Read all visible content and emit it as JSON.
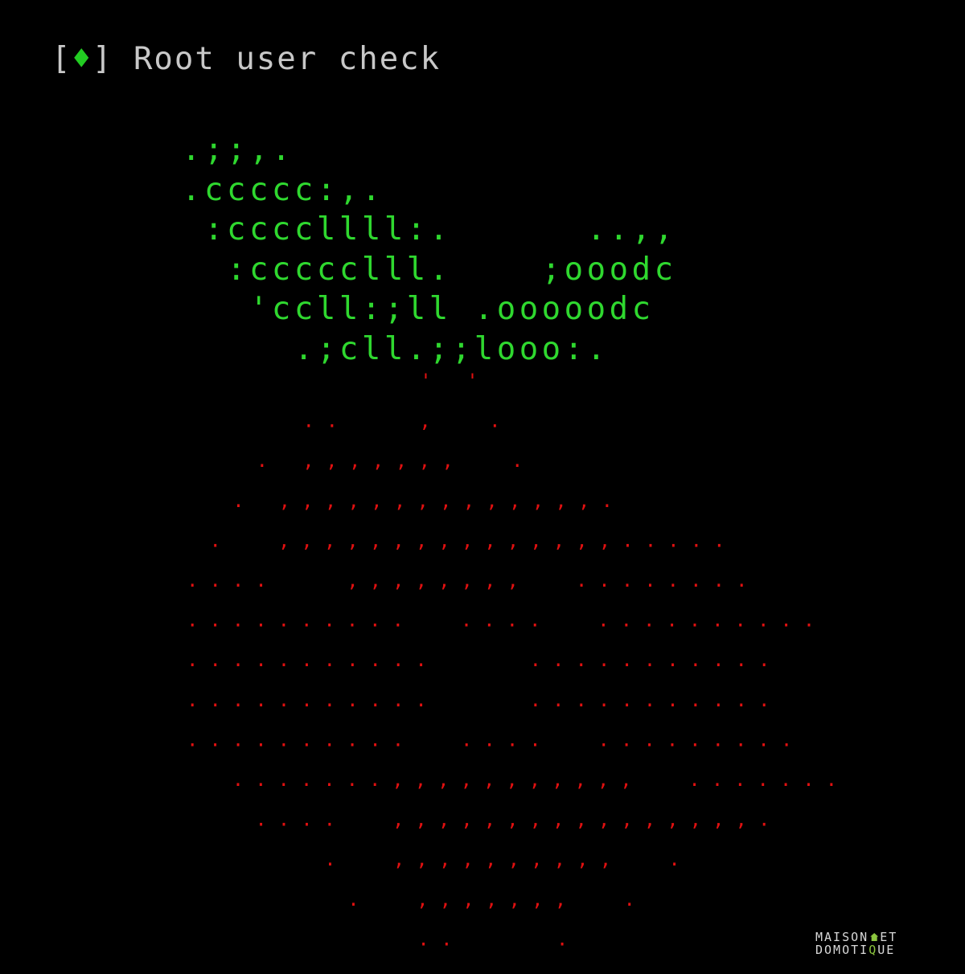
{
  "terminal": {
    "status": {
      "bracket_open": "[",
      "symbol": "♦",
      "bracket_close": "]",
      "text": "Root user check"
    },
    "leaf_lines": [
      ".;;,.",
      ".ccccc:,.",
      " :ccccllll:.      ..,,",
      "  :ccccclll.    ;ooodc",
      "   'ccll:;ll .ooooodc",
      "     .;cll.;;looo:."
    ],
    "berry_rows": [
      "          ' '",
      "     ..   ,  .",
      "   . ,,,,,,,  .",
      "  . ,,,,,,,,,,,,,,.",
      " .  ,,,,,,,,,,,,,,,.....",
      "....   ,,,,,,,,  ........",
      "..........  ....  ..........",
      "...........    ...........",
      "...........    ...........",
      "..........  ....  .........",
      "  .......,,,,,,,,,,,  .......",
      "   ....  ,,,,,,,,,,,,,,,,.",
      "      .  ,,,,,,,,,,  .",
      "       .  ,,,,,,,  .",
      "          ..    ."
    ],
    "colors": {
      "background": "#000000",
      "status_text": "#c8c8c8",
      "status_symbol": "#22cc22",
      "leaf": "#2fd82f",
      "berry": "#e01010"
    }
  },
  "watermark": {
    "line1_a": "MAISON",
    "line1_b": "ET",
    "line2_a": "DOMOTI",
    "line2_accent": "Q",
    "line2_b": "UE"
  }
}
